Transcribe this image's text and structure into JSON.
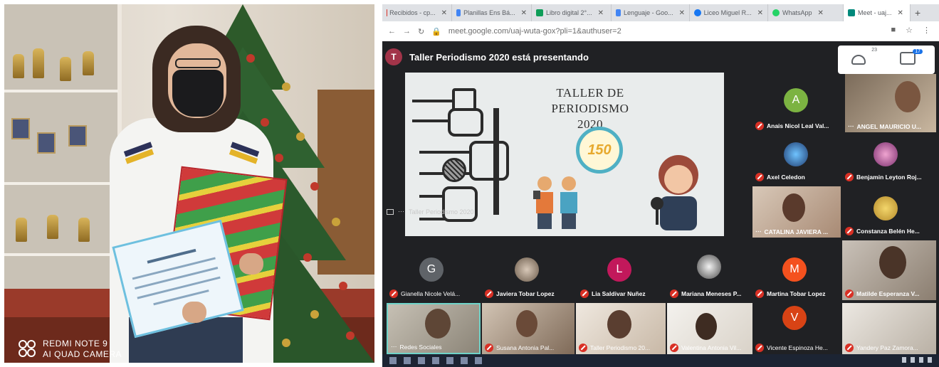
{
  "left_photo": {
    "watermark_line1": "REDMI NOTE 9",
    "watermark_line2": "AI QUAD CAMERA",
    "colors": {
      "wall": "#e0d8cc",
      "shirt": "#f4f4f2",
      "mask": "#1b1b1d",
      "gift": "#d03a3a",
      "diploma_border": "#6ec0df"
    }
  },
  "browser": {
    "tabs": [
      {
        "label": "Recibidos - cp...",
        "icon": "gmail-icon",
        "color": "#d93025"
      },
      {
        "label": "Planillas Ens Bá...",
        "icon": "drive-icon",
        "color": "#4285f4"
      },
      {
        "label": "Libro digital 2°...",
        "icon": "sheets-icon",
        "color": "#0f9d58"
      },
      {
        "label": "Lenguaje - Goo...",
        "icon": "drive-icon",
        "color": "#4285f4"
      },
      {
        "label": "Liceo Miguel R...",
        "icon": "facebook-icon",
        "color": "#1877f2"
      },
      {
        "label": "WhatsApp",
        "icon": "whatsapp-icon",
        "color": "#25d366"
      },
      {
        "label": "Meet - uaj...",
        "icon": "meet-icon",
        "color": "#00897b"
      }
    ],
    "url": "meet.google.com/uaj-wuta-gox?pli=1&authuser=2"
  },
  "meet": {
    "presenter_initial": "T",
    "presenter_text": "Taller Periodismo 2020 está presentando",
    "people_count": "23",
    "chat_badge": "17",
    "slide": {
      "title_line1": "TALLER DE PERIODISMO",
      "title_line2": "2020",
      "badge": "150",
      "caption": "Taller Periodismo 2020"
    },
    "participants": [
      {
        "name": "Anais Nicol Leal Val...",
        "type": "letter",
        "initial": "A",
        "color": "#7cb342"
      },
      {
        "name": "ANGEL MAURICIO U...",
        "type": "video"
      },
      {
        "name": "Axel Celedon",
        "type": "photo"
      },
      {
        "name": "Benjamin Leyton Roj...",
        "type": "photo"
      },
      {
        "name": "CATALINA JAVIERA ...",
        "type": "video"
      },
      {
        "name": "Constanza Belén He...",
        "type": "photo"
      },
      {
        "name": "Gianella Nicole Velá...",
        "type": "letter",
        "initial": "G",
        "color": "#5f6368"
      },
      {
        "name": "Javiera Tobar Lopez",
        "type": "photo"
      },
      {
        "name": "Lia Saldivar Nuñez",
        "type": "letter",
        "initial": "L",
        "color": "#c2185b"
      },
      {
        "name": "Mariana Meneses P...",
        "type": "photo"
      },
      {
        "name": "Martina Tobar Lopez",
        "type": "letter",
        "initial": "M",
        "color": "#f4511e"
      },
      {
        "name": "Matilde Esperanza V...",
        "type": "video"
      },
      {
        "name": "Redes Sociales",
        "type": "video"
      },
      {
        "name": "Susana Antonia Pal...",
        "type": "video"
      },
      {
        "name": "Taller Periodismo 20...",
        "type": "video"
      },
      {
        "name": "Valentina Antonia Vil...",
        "type": "video"
      },
      {
        "name": "Vicente Espinoza He...",
        "type": "letter",
        "initial": "V",
        "color": "#d84315"
      },
      {
        "name": "Yandery Paz Zamora...",
        "type": "video"
      }
    ]
  }
}
